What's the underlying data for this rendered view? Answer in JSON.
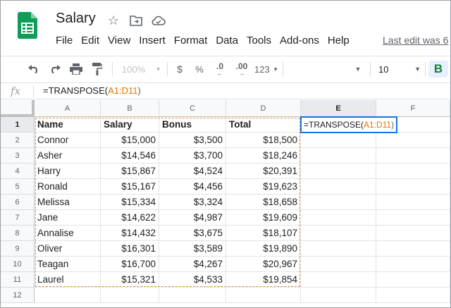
{
  "app": {
    "title": "Salary",
    "last_edit": "Last edit was 6"
  },
  "menu": [
    "File",
    "Edit",
    "View",
    "Insert",
    "Format",
    "Data",
    "Tools",
    "Add-ons",
    "Help"
  ],
  "toolbar": {
    "zoom": "100%",
    "currency": "$",
    "percent": "%",
    "dec_decrease": ".0",
    "dec_increase": ".00",
    "more_formats": "123",
    "font_size": "10",
    "bold": "B"
  },
  "formula_bar": {
    "fx": "fx",
    "prefix": "=TRANSPOSE(",
    "range": "A1:D11",
    "suffix": ")"
  },
  "grid": {
    "columns": [
      "A",
      "B",
      "C",
      "D",
      "E",
      "F"
    ],
    "rows": [
      "1",
      "2",
      "3",
      "4",
      "5",
      "6",
      "7",
      "8",
      "9",
      "10",
      "11",
      "12"
    ],
    "header_row": [
      "Name",
      "Salary",
      "Bonus",
      "Total"
    ],
    "data": [
      [
        "Connor",
        "$15,000",
        "$3,500",
        "$18,500"
      ],
      [
        "Asher",
        "$14,546",
        "$3,700",
        "$18,246"
      ],
      [
        "Harry",
        "$15,867",
        "$4,524",
        "$20,391"
      ],
      [
        "Ronald",
        "$15,167",
        "$4,456",
        "$19,623"
      ],
      [
        "Melissa",
        "$15,334",
        "$3,324",
        "$18,658"
      ],
      [
        "Jane",
        "$14,622",
        "$4,987",
        "$19,609"
      ],
      [
        "Annalise",
        "$14,432",
        "$3,675",
        "$18,107"
      ],
      [
        "Oliver",
        "$16,301",
        "$3,589",
        "$19,890"
      ],
      [
        "Teagan",
        "$16,700",
        "$4,267",
        "$20,967"
      ],
      [
        "Laurel",
        "$15,321",
        "$4,533",
        "$19,854"
      ]
    ],
    "active_cell": {
      "prefix": "=TRANSPOSE(",
      "range": "A1:D11",
      "suffix": ")"
    },
    "active_col": "E",
    "active_row": "1"
  },
  "colors": {
    "accent": "#1a73e8",
    "range": "#e37400",
    "sheets_green": "#0f9d58"
  }
}
